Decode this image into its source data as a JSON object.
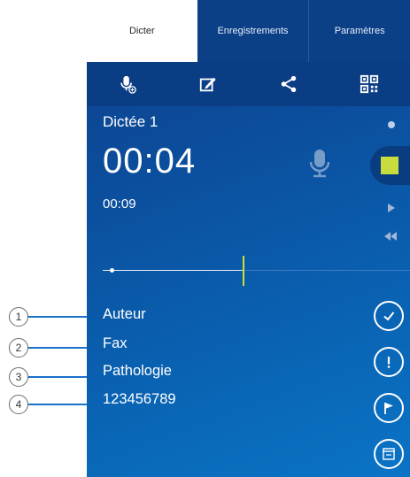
{
  "tabs": [
    {
      "label": "Dicter",
      "active": true
    },
    {
      "label": "Enregistrements",
      "active": false
    },
    {
      "label": "Paramètres",
      "active": false
    }
  ],
  "toolbar": {
    "icons": [
      "microphone-add-icon",
      "edit-icon",
      "share-icon",
      "qr-code-icon"
    ]
  },
  "dictation": {
    "title": "Dictée 1",
    "position": "00:04",
    "total": "00:09"
  },
  "fields": [
    "Auteur",
    "Fax",
    "Pathologie",
    "123456789"
  ],
  "callouts": [
    "1",
    "2",
    "3",
    "4"
  ],
  "side_icons": [
    "record-dot-icon",
    "stop-icon",
    "play-icon",
    "rewind-icon"
  ],
  "right_buttons": [
    "check-icon",
    "priority-icon",
    "flag-icon",
    "archive-icon"
  ],
  "colors": {
    "accent": "#c8dd3d",
    "background": "#0b4f9e",
    "callout_line": "#1a73c8"
  }
}
